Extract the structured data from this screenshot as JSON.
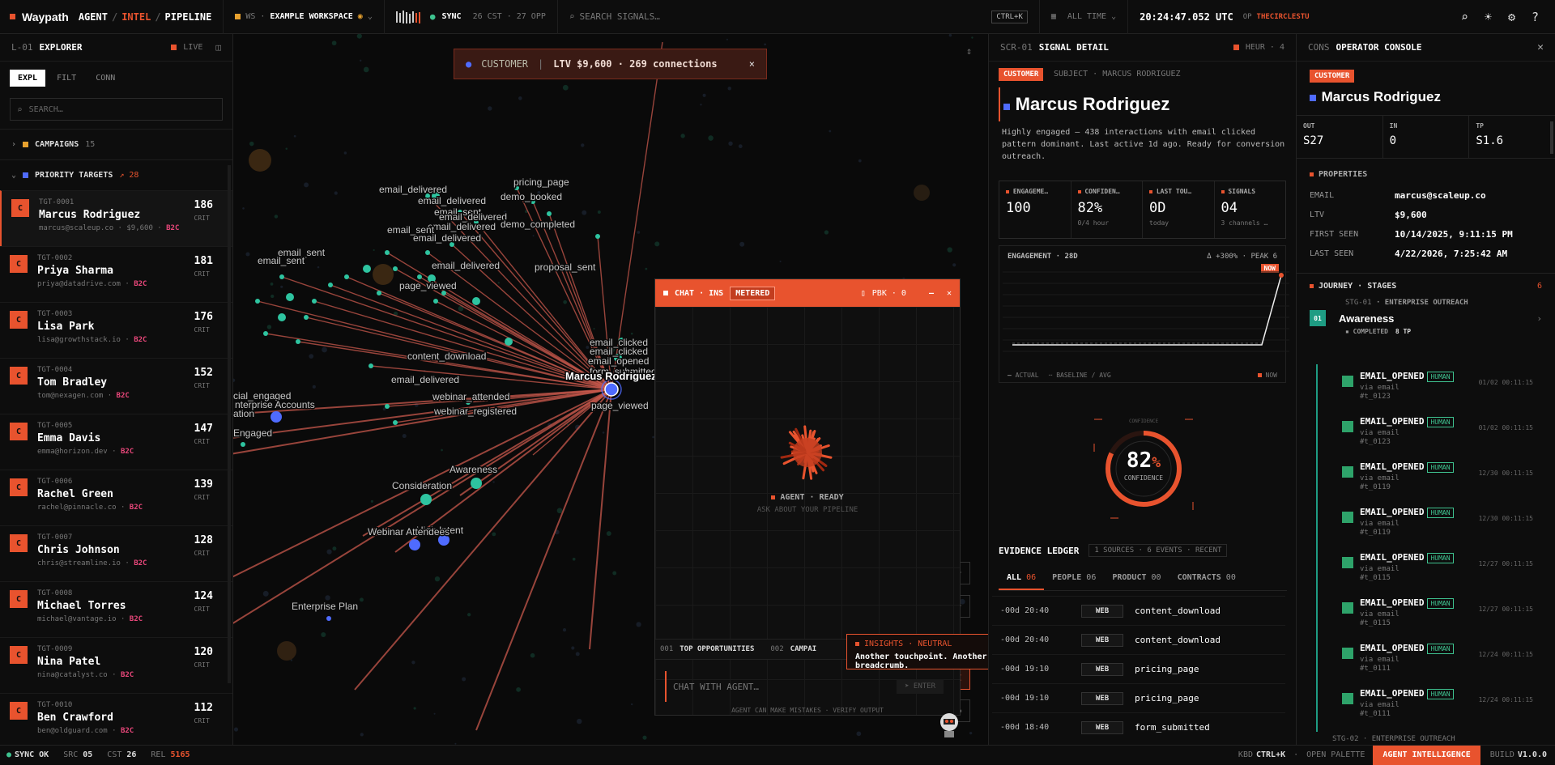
{
  "topbar": {
    "brand": "Waypath",
    "crumb_1": "AGENT",
    "crumb_2": "INTEL",
    "crumb_3": "PIPELINE",
    "ws_prefix": "WS",
    "workspace": "EXAMPLE WORKSPACE",
    "sync_label": "SYNC",
    "sync_meta": "26 CST · 27 OPP",
    "search_placeholder": "SEARCH SIGNALS…",
    "shortcut": "CTRL+K",
    "range": "ALL TIME",
    "clock": "20:24:47.052 UTC",
    "op_prefix": "OP",
    "operator": "THECIRCLESTU"
  },
  "explorer": {
    "code": "L-01",
    "title": "EXPLORER",
    "live": "LIVE",
    "tabs": [
      "EXPL",
      "FILT",
      "CONN"
    ],
    "search_placeholder": "SEARCH…",
    "campaigns_label": "CAMPAIGNS",
    "campaigns_count": "15",
    "priority_label": "PRIORITY TARGETS",
    "priority_count": "↗ 28",
    "targets": [
      {
        "id": "TGT-0001",
        "name": "Marcus Rodriguez",
        "meta": "marcus@scaleup.co · $9,600 ·",
        "tag": "B2C",
        "score": "186",
        "crit": "CRIT"
      },
      {
        "id": "TGT-0002",
        "name": "Priya Sharma",
        "meta": "priya@datadrive.com ·",
        "tag": "B2C",
        "score": "181",
        "crit": "CRIT"
      },
      {
        "id": "TGT-0003",
        "name": "Lisa Park",
        "meta": "lisa@growthstack.io ·",
        "tag": "B2C",
        "score": "176",
        "crit": "CRIT"
      },
      {
        "id": "TGT-0004",
        "name": "Tom Bradley",
        "meta": "tom@nexagen.com ·",
        "tag": "B2C",
        "score": "152",
        "crit": "CRIT"
      },
      {
        "id": "TGT-0005",
        "name": "Emma Davis",
        "meta": "emma@horizon.dev ·",
        "tag": "B2C",
        "score": "147",
        "crit": "CRIT"
      },
      {
        "id": "TGT-0006",
        "name": "Rachel Green",
        "meta": "rachel@pinnacle.co ·",
        "tag": "B2C",
        "score": "139",
        "crit": "CRIT"
      },
      {
        "id": "TGT-0007",
        "name": "Chris Johnson",
        "meta": "chris@streamline.io ·",
        "tag": "B2C",
        "score": "128",
        "crit": "CRIT"
      },
      {
        "id": "TGT-0008",
        "name": "Michael Torres",
        "meta": "michael@vantage.io ·",
        "tag": "B2C",
        "score": "124",
        "crit": "CRIT"
      },
      {
        "id": "TGT-0009",
        "name": "Nina Patel",
        "meta": "nina@catalyst.co ·",
        "tag": "B2C",
        "score": "120",
        "crit": "CRIT"
      },
      {
        "id": "TGT-0010",
        "name": "Ben Crawford",
        "meta": "ben@oldguard.com ·",
        "tag": "B2C",
        "score": "112",
        "crit": "CRIT"
      }
    ]
  },
  "graph": {
    "banner_label": "CUSTOMER",
    "banner_text": "LTV $9,600 · 269 connections",
    "center_label": "Marcus Rodriguez",
    "labels": [
      "email_delivered",
      "pricing_page",
      "email_delivered",
      "demo_booked",
      "email_sent",
      "email_delivered",
      "demo_completed",
      "email_delivered",
      "email_sent",
      "proposal_sent",
      "page_viewed",
      "email_clicked",
      "email_delivered",
      "email_sent",
      "email_sent",
      "email_delivered",
      "content_download",
      "email_clicked",
      "email_opened",
      "form_submitted",
      "email_delivered",
      "page_viewed",
      "webinar_attended",
      "webinar_registered",
      "Awareness",
      "Consideration",
      "High Intent",
      "Webinar Attendees",
      "Enterprise Plan",
      "cial_engaged",
      "nterprise Accounts",
      "ation",
      "Engaged"
    ]
  },
  "chat": {
    "title": "CHAT · INS",
    "metered": "METERED",
    "pbk": "PBK · 0",
    "status": "AGENT · READY",
    "hint": "ASK ABOUT YOUR PIPELINE",
    "chip_1_num": "001",
    "chip_1": "TOP OPPORTUNITIES",
    "chip_2_num": "002",
    "chip_2": "CAMPAI",
    "input_placeholder": "CHAT WITH AGENT…",
    "enter": "ENTER",
    "disclaimer": "AGENT CAN MAKE MISTAKES · VERIFY OUTPUT"
  },
  "insights": {
    "title": "INSIGHTS · NEUTRAL",
    "text": "Another touchpoint. Another breadcrumb."
  },
  "signal": {
    "code": "SCR-01",
    "title": "SIGNAL DETAIL",
    "heur": "HEUR · 4",
    "badge": "CUSTOMER",
    "subject": "SUBJECT · MARCUS RODRIGUEZ",
    "name": "Marcus Rodriguez",
    "desc": "Highly engaged — 438 interactions with email clicked pattern dominant. Last active 1d ago. Ready for conversion outreach.",
    "stats": [
      {
        "label": "ENGAGEME…",
        "value": "100",
        "sub": ""
      },
      {
        "label": "CONFIDEN…",
        "value": "82%",
        "sub": "0/4 hour"
      },
      {
        "label": "LAST TOU…",
        "value": "0D",
        "sub": "today"
      },
      {
        "label": "SIGNALS",
        "value": "04",
        "sub": "3 channels …"
      }
    ],
    "chart_title": "ENGAGEMENT · 28D",
    "chart_delta": "Δ +300%",
    "chart_peak": "· PEAK 6",
    "chart_now": "NOW",
    "legend_actual": "ACTUAL",
    "legend_baseline": "BASELINE / AVG",
    "legend_now": "NOW",
    "gauge_value": "82",
    "gauge_unit": "%",
    "gauge_label": "CONFIDENCE",
    "gauge_top": "CONFIDENCE",
    "ledger_title": "EVIDENCE LEDGER",
    "ledger_meta": "1 SOURCES · 6 EVENTS · RECENT",
    "ledger_tabs": [
      {
        "label": "ALL",
        "count": "06"
      },
      {
        "label": "PEOPLE",
        "count": "06"
      },
      {
        "label": "PRODUCT",
        "count": "00"
      },
      {
        "label": "CONTRACTS",
        "count": "00"
      }
    ],
    "ledger_rows": [
      {
        "time": "-00d 20:40",
        "src": "WEB",
        "event": "content_download"
      },
      {
        "time": "-00d 20:40",
        "src": "WEB",
        "event": "content_download"
      },
      {
        "time": "-00d 19:10",
        "src": "WEB",
        "event": "pricing_page"
      },
      {
        "time": "-00d 19:10",
        "src": "WEB",
        "event": "pricing_page"
      },
      {
        "time": "-00d 18:40",
        "src": "WEB",
        "event": "form_submitted"
      }
    ]
  },
  "console": {
    "code": "CONS",
    "title": "OPERATOR CONSOLE",
    "badge": "CUSTOMER",
    "name": "Marcus Rodriguez",
    "out_label": "OUT",
    "out_value": "S27",
    "in_label": "IN",
    "in_value": "0",
    "tp_label": "TP",
    "tp_value": "S1.6",
    "properties_title": "PROPERTIES",
    "props": [
      {
        "k": "EMAIL",
        "v": "marcus@scaleup.co"
      },
      {
        "k": "LTV",
        "v": "$9,600"
      },
      {
        "k": "FIRST SEEN",
        "v": "10/14/2025, 9:11:15 PM"
      },
      {
        "k": "LAST SEEN",
        "v": "4/22/2026, 7:25:42 AM"
      }
    ],
    "journey_title": "JOURNEY · STAGES",
    "journey_count": "6",
    "stage_code": "STG-01",
    "stage_type": "· ENTERPRISE OUTREACH",
    "stage_num": "01",
    "stage_name": "Awareness",
    "stage_status": "COMPLETED",
    "stage_tp": "8 TP",
    "events": [
      {
        "a": "EMAIL_OPENED",
        "h": "HUMAN",
        "b": "via email",
        "c": "#t_0123",
        "ts": "01/02 00:11:15"
      },
      {
        "a": "EMAIL_OPENED",
        "h": "HUMAN",
        "b": "via email",
        "c": "#t_0123",
        "ts": "01/02 00:11:15"
      },
      {
        "a": "EMAIL_OPENED",
        "h": "HUMAN",
        "b": "via email",
        "c": "#t_0119",
        "ts": "12/30 00:11:15"
      },
      {
        "a": "EMAIL_OPENED",
        "h": "HUMAN",
        "b": "via email",
        "c": "#t_0119",
        "ts": "12/30 00:11:15"
      },
      {
        "a": "EMAIL_OPENED",
        "h": "HUMAN",
        "b": "via email",
        "c": "#t_0115",
        "ts": "12/27 00:11:15"
      },
      {
        "a": "EMAIL_OPENED",
        "h": "HUMAN",
        "b": "via email",
        "c": "#t_0115",
        "ts": "12/27 00:11:15"
      },
      {
        "a": "EMAIL_OPENED",
        "h": "HUMAN",
        "b": "via email",
        "c": "#t_0111",
        "ts": "12/24 00:11:15"
      },
      {
        "a": "EMAIL_OPENED",
        "h": "HUMAN",
        "b": "via email",
        "c": "#t_0111",
        "ts": "12/24 00:11:15"
      }
    ],
    "next_stage": "STG-02 · ENTERPRISE OUTREACH"
  },
  "bottombar": {
    "sync": "SYNC OK",
    "src_label": "SRC",
    "src": "05",
    "cst_label": "CST",
    "cst": "26",
    "rel_label": "REL",
    "rel": "5165",
    "kbd_label": "KBD",
    "kbd": "CTRL+K",
    "palette": "OPEN PALETTE",
    "agent": "AGENT INTELLIGENCE",
    "build_label": "BUILD",
    "build": "V1.0.0"
  }
}
